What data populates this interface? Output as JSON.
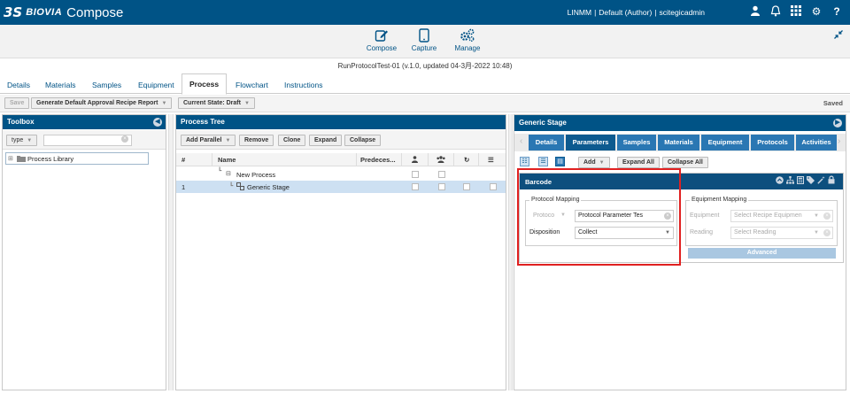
{
  "app": {
    "logo": "3S",
    "company": "BIOVIA",
    "name": "Compose"
  },
  "user": {
    "site": "LINMM",
    "role": "Default (Author)",
    "name": "scitegicadmin"
  },
  "modes": [
    {
      "label": "Compose"
    },
    {
      "label": "Capture"
    },
    {
      "label": "Manage"
    }
  ],
  "page_title": "RunProtocolTest-01 (v.1.0, updated 04-3月-2022 10:48)",
  "tabs": [
    "Details",
    "Materials",
    "Samples",
    "Equipment",
    "Process",
    "Flowchart",
    "Instructions"
  ],
  "actions": {
    "save": "Save",
    "report": "Generate Default Approval Recipe Report",
    "state": "Current State: Draft",
    "saved": "Saved"
  },
  "toolbox": {
    "title": "Toolbox",
    "type_label": "type",
    "search_value": "",
    "tree_item": "Process Library"
  },
  "process_tree": {
    "title": "Process Tree",
    "buttons": {
      "add_parallel": "Add Parallel",
      "remove": "Remove",
      "clone": "Clone",
      "expand": "Expand",
      "collapse": "Collapse"
    },
    "columns": {
      "num": "#",
      "name": "Name",
      "predecessors": "Predeces..."
    },
    "rows": [
      {
        "num": "",
        "name": "New Process"
      },
      {
        "num": "1",
        "name": "Generic Stage"
      }
    ]
  },
  "stage": {
    "title": "Generic Stage",
    "tabs": [
      "Details",
      "Parameters",
      "Samples",
      "Materials",
      "Equipment",
      "Protocols",
      "Activities"
    ],
    "toolbar": {
      "add": "Add",
      "expand_all": "Expand All",
      "collapse_all": "Collapse All"
    },
    "barcode": {
      "title": "Barcode",
      "protocol_mapping": {
        "legend": "Protocol Mapping",
        "protocol_label": "Protoco",
        "protocol_value": "Protocol Parameter Tes",
        "disposition_label": "Disposition",
        "disposition_value": "Collect"
      },
      "equipment_mapping": {
        "legend": "Equipment Mapping",
        "equipment_label": "Equipment",
        "equipment_placeholder": "Select Recipe Equipmen",
        "reading_label": "Reading",
        "reading_placeholder": "Select Reading",
        "advanced": "Advanced"
      }
    }
  },
  "colors": {
    "brand": "#005386",
    "tab": "#2a77b3",
    "selected_row": "#cde0f2",
    "highlight": "#e02020"
  }
}
